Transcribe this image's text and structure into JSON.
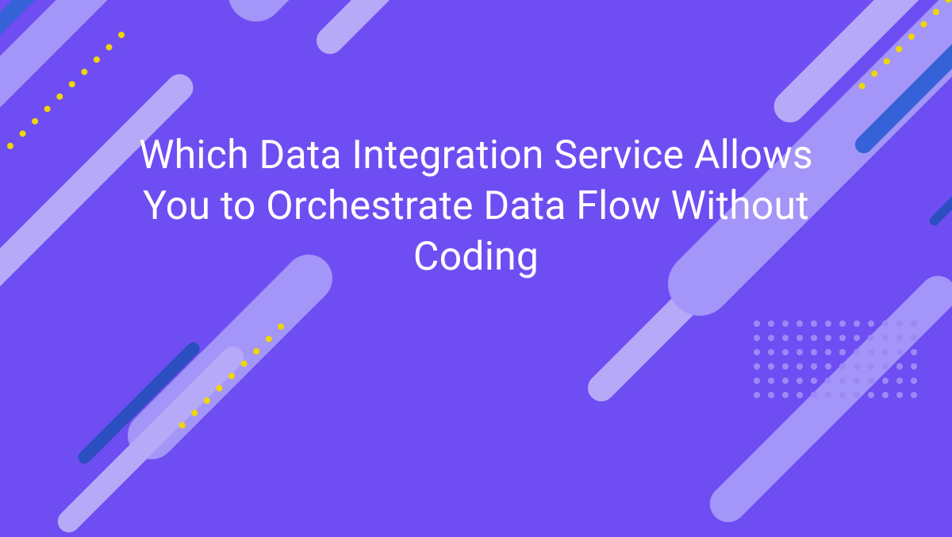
{
  "title": "Which Data Integration Service Allows You to Orchestrate Data Flow Without Coding",
  "colors": {
    "background": "#6e4ef2",
    "stripes_light": [
      "#a495f8",
      "#b6aaf8"
    ],
    "accent_blue": [
      "#3562d6",
      "#2b4fc0"
    ],
    "dot_yellow": "#f0d700",
    "dot_grid": "#9b8af6",
    "text": "#ffffff"
  },
  "icons": {
    "dotted_line": "yellow-dotted-line",
    "dot_grid": "purple-dot-grid"
  }
}
